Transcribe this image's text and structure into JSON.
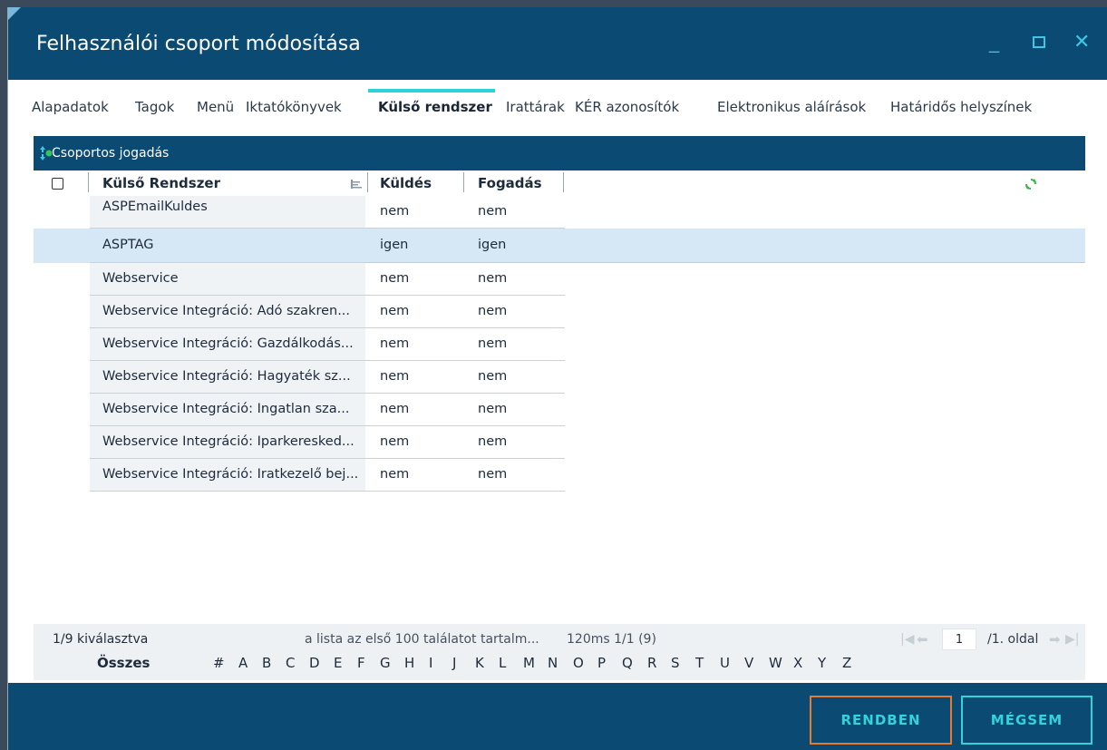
{
  "window": {
    "title": "Felhasználói csoport módosítása",
    "controls": {
      "minimize": "_",
      "close": "✕"
    }
  },
  "tabs": [
    {
      "label": "Alapadatok",
      "active": false
    },
    {
      "label": "Tagok",
      "active": false
    },
    {
      "label": "Menü",
      "active": false
    },
    {
      "label": "Iktatókönyvek",
      "active": false
    },
    {
      "label": "Külső rendszer",
      "active": true
    },
    {
      "label": "Irattárak",
      "active": false
    },
    {
      "label": "KÉR azonosítók",
      "active": false
    },
    {
      "label": "Elektronikus aláírások",
      "active": false
    },
    {
      "label": "Határidős helyszínek",
      "active": false
    }
  ],
  "grid": {
    "header_label": "Csoportos jogadás",
    "columns": {
      "name": "Külső Rendszer",
      "send": "Küldés",
      "receive": "Fogadás"
    },
    "rows": [
      {
        "name": "ASPEmailKuldes",
        "send": "nem",
        "receive": "nem",
        "selected": false
      },
      {
        "name": "ASPTAG",
        "send": "igen",
        "receive": "igen",
        "selected": true
      },
      {
        "name": "Webservice",
        "send": "nem",
        "receive": "nem",
        "selected": false
      },
      {
        "name": "Webservice Integráció: Adó szakren...",
        "send": "nem",
        "receive": "nem",
        "selected": false
      },
      {
        "name": "Webservice Integráció: Gazdálkodás...",
        "send": "nem",
        "receive": "nem",
        "selected": false
      },
      {
        "name": "Webservice Integráció: Hagyaték sz...",
        "send": "nem",
        "receive": "nem",
        "selected": false
      },
      {
        "name": "Webservice Integráció: Ingatlan sza...",
        "send": "nem",
        "receive": "nem",
        "selected": false
      },
      {
        "name": "Webservice Integráció: Iparkeresked...",
        "send": "nem",
        "receive": "nem",
        "selected": false
      },
      {
        "name": "Webservice Integráció: Iratkezelő bej...",
        "send": "nem",
        "receive": "nem",
        "selected": false
      }
    ]
  },
  "footer": {
    "selection": "1/9 kiválasztva",
    "info": "a lista az első 100 találatot tartalm...",
    "timing": "120ms 1/1 (9)",
    "page": "1",
    "page_suffix": "/1. oldal",
    "all_label": "Összes",
    "letters": [
      "#",
      "A",
      "B",
      "C",
      "D",
      "E",
      "F",
      "G",
      "H",
      "I",
      "J",
      "K",
      "L",
      "M",
      "N",
      "O",
      "P",
      "Q",
      "R",
      "S",
      "T",
      "U",
      "V",
      "W",
      "X",
      "Y",
      "Z"
    ]
  },
  "buttons": {
    "ok": "RENDBEN",
    "cancel": "MÉGSEM"
  },
  "colors": {
    "primary": "#0b4a72",
    "accent": "#34d2d9",
    "ok_border": "#e97a2d",
    "selected_row": "#d6e7f5"
  }
}
